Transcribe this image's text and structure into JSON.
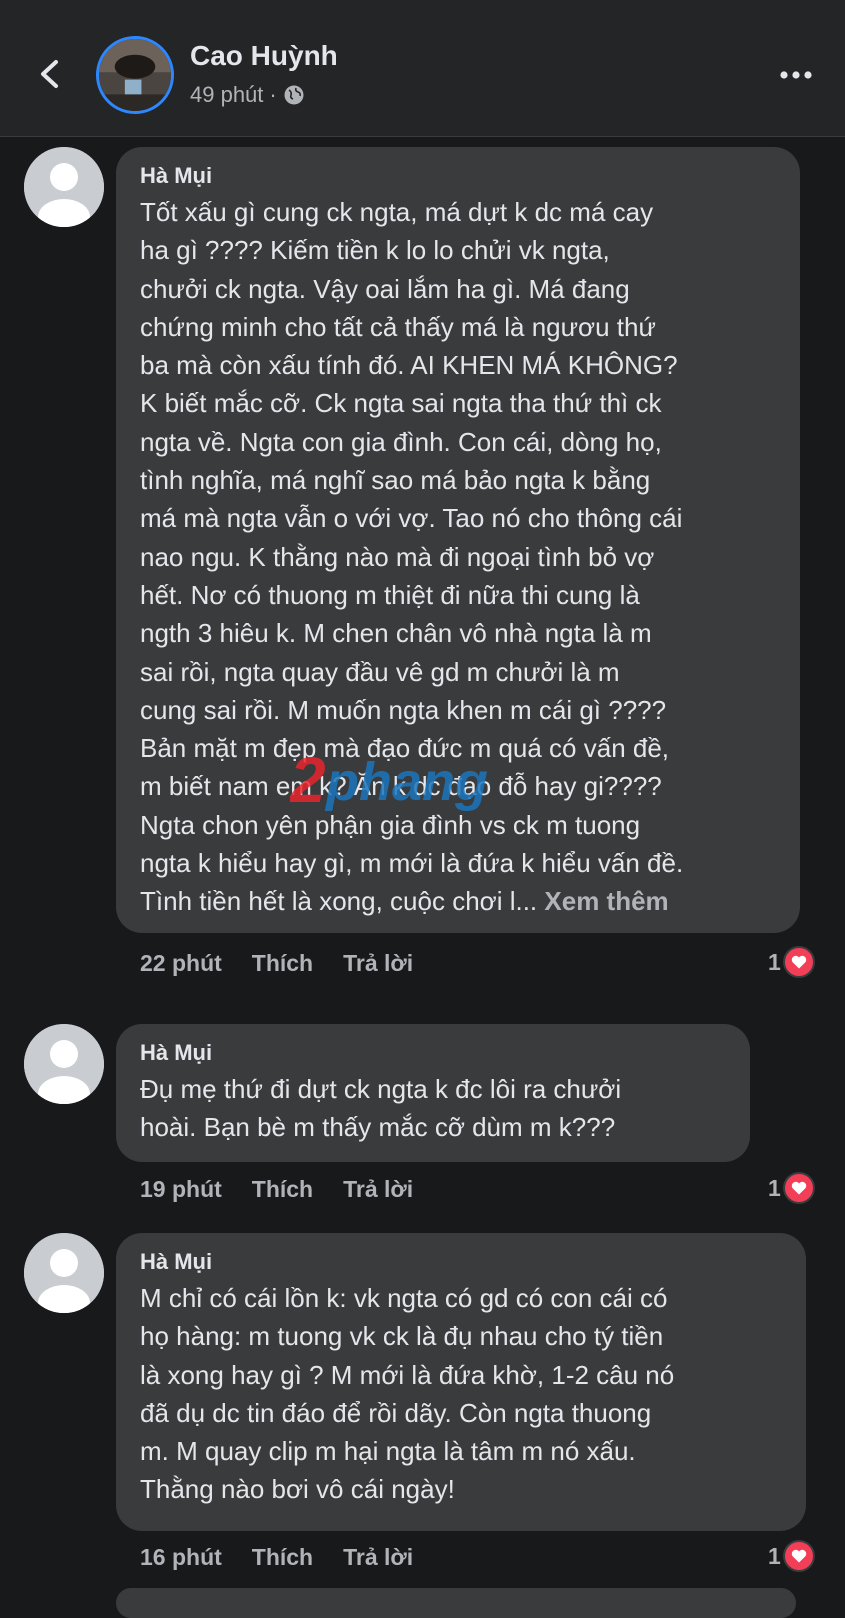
{
  "header": {
    "poster_name": "Cao Huỳnh",
    "time": "49 phút",
    "separator": "·",
    "back_icon": "chevron-left-icon",
    "privacy_icon": "globe-icon",
    "more_icon": "more-dots-icon"
  },
  "comments": [
    {
      "author": "Hà Mụi",
      "text": "Tốt xấu gì cung ck ngta, má dựt k dc má cay\nha gì ????  Kiếm tiền k lo lo chửi vk ngta,\nchưởi ck ngta. Vậy oai lắm ha gì. Má đang\nchứng minh cho tất cả thấy má là ngươu thứ\nba mà còn xấu tính đó. AI KHEN MÁ KHÔNG?\nK biết mắc cỡ.  Ck ngta sai ngta tha thứ thì ck\nngta về. Ngta con gia đình. Con cái, dòng họ,\ntình nghĩa, má nghĩ sao má bảo ngta k bằng\nmá mà ngta vẫn o với vợ. Tao nó cho thông cái\nnao  ngu. K thằng nào mà đi ngoại tình bỏ vợ\nhết.  Nơ có thuong m thiệt đi nữa thi cung là\nngth 3 hiêu k. M chen chân vô nhà ngta là m\nsai rồi, ngta quay đầu vê gd m chưởi là m\ncung sai rồi. M muốn ngta khen m cái gì ????\nBản mặt m đẹp mà đạo đức m quá có vấn đề,\nm biết nam em k? Ăn k dc đạo đỗ hay gi????\nNgta chon yên phận gia đình vs ck m tuong\nngta k hiểu hay gì, m mới là đứa k hiểu vấn đề.\nTình tiền hết là xong, cuộc chơi l...",
      "see_more": "Xem thêm",
      "time": "22 phút",
      "like": "Thích",
      "reply": "Trả lời",
      "reaction_count": "1"
    },
    {
      "author": "Hà Mụi",
      "text": "Đụ mẹ thứ đi dựt ck ngta k đc lôi ra chưởi\nhoài. Bạn bè m thấy mắc cỡ dùm m k???",
      "time": "19 phút",
      "like": "Thích",
      "reply": "Trả lời",
      "reaction_count": "1"
    },
    {
      "author": "Hà Mụi",
      "text": "M chỉ có cái lồn k: vk ngta có gd có con cái có\nhọ hàng: m tuong vk ck là đụ nhau cho tý tiền\nlà xong hay gì ?  M mới là đứa khờ, 1-2 câu nó\nđã dụ dc tin đáo để rồi dãy.   Còn ngta thuong\nm. M quay clip m hại ngta là tâm m nó xấu.\nThằng nào bơi vô cái ngày!",
      "time": "16 phút",
      "like": "Thích",
      "reply": "Trả lời",
      "reaction_count": "1"
    }
  ],
  "watermark": {
    "text": "2phang"
  },
  "colors": {
    "background": "#18191a",
    "bubble": "#3a3b3c",
    "text": "#e4e6eb",
    "secondary": "#b0b3b8",
    "heart": "#f33e58",
    "accent": "#2d88ff"
  }
}
